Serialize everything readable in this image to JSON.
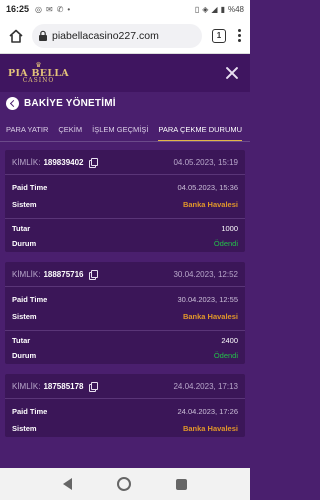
{
  "status_bar": {
    "time": "16:25",
    "battery": "%48"
  },
  "browser": {
    "url": "piabellacasino227.com",
    "tab_count": "1"
  },
  "app": {
    "logo_main": "PIA BELLA",
    "logo_sub": "CASINO"
  },
  "page": {
    "title": "BAKİYE YÖNETİMİ"
  },
  "tabs": [
    {
      "label": "PARA YATIR",
      "active": false
    },
    {
      "label": "ÇEKİM",
      "active": false
    },
    {
      "label": "İŞLEM GEÇMİŞİ",
      "active": false
    },
    {
      "label": "PARA ÇEKME DURUMU",
      "active": true
    }
  ],
  "labels": {
    "kimlik": "KİMLİK:",
    "paid_time": "Paid Time",
    "sistem": "Sistem",
    "tutar": "Tutar",
    "durum": "Durum"
  },
  "withdrawals": [
    {
      "id": "189839402",
      "created": "04.05.2023, 15:19",
      "paid_time": "04.05.2023, 15:36",
      "system": "Banka Havalesi",
      "amount": "1000",
      "status": "Ödendi"
    },
    {
      "id": "188875716",
      "created": "30.04.2023, 12:52",
      "paid_time": "30.04.2023, 12:55",
      "system": "Banka Havalesi",
      "amount": "2400",
      "status": "Ödendi"
    },
    {
      "id": "187585178",
      "created": "24.04.2023, 17:13",
      "paid_time": "24.04.2023, 17:26",
      "system": "Banka Havalesi",
      "amount": "",
      "status": ""
    }
  ],
  "colors": {
    "background": "#4a1f6e",
    "card": "#3b1658",
    "accent_gold": "#e2b64a",
    "system_orange": "#e0962a",
    "status_green": "#23c04a"
  }
}
